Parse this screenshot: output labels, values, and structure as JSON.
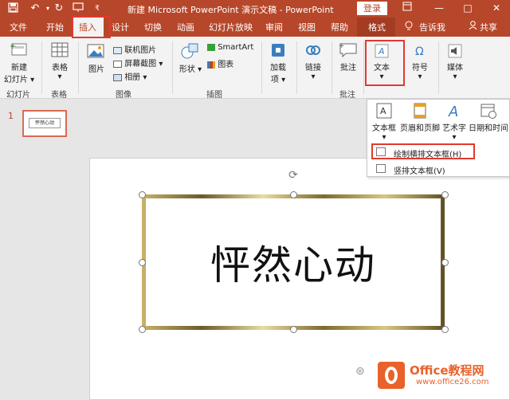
{
  "window": {
    "title": "新建 Microsoft PowerPoint 演示文稿 - PowerPoint",
    "login_label": "登录"
  },
  "qat": {
    "icons": [
      "save-icon",
      "undo-icon",
      "redo-icon",
      "start-from-beginning-icon",
      "customize-icon"
    ]
  },
  "tabs": {
    "file": "文件",
    "home": "开始",
    "insert": "插入",
    "design": "设计",
    "transitions": "切换",
    "animations": "动画",
    "slideshow": "幻灯片放映",
    "review": "审阅",
    "view": "视图",
    "help": "帮助",
    "format": "格式",
    "tell_me": "告诉我",
    "share": "共享"
  },
  "ribbon": {
    "new_slide_line1": "新建",
    "new_slide_line2": "幻灯片",
    "table": "表格",
    "pictures": "图片",
    "online_pictures": "联机图片",
    "screenshot": "屏幕截图",
    "album": "相册",
    "shapes": "形状",
    "smartart": "SmartArt",
    "chart": "图表",
    "addins_line1": "加载",
    "addins_line2": "项",
    "links": "链接",
    "comment": "批注",
    "text": "文本",
    "symbols": "符号",
    "media": "媒体",
    "groups": {
      "slides": "幻灯片",
      "tables": "表格",
      "images": "图像",
      "illustrations": "插图",
      "comments": "批注"
    }
  },
  "text_dropdown": {
    "textbox": "文本框",
    "header_footer": "页眉和页脚",
    "wordart": "艺术字",
    "datetime": "日期和时间",
    "draw_horizontal": "绘制横排文本框(H)",
    "vertical": "竖排文本框(V)"
  },
  "slides_pane": {
    "slide_number": "1",
    "thumb_text": "怦然心动"
  },
  "slide": {
    "textbox_text": "怦然心动"
  },
  "watermark": {
    "title": "Office教程网",
    "sub": "www.office26.com"
  },
  "colors": {
    "accent": "#b7472a",
    "highlight_box": "#e03a2f",
    "watermark": "#e8622a"
  }
}
